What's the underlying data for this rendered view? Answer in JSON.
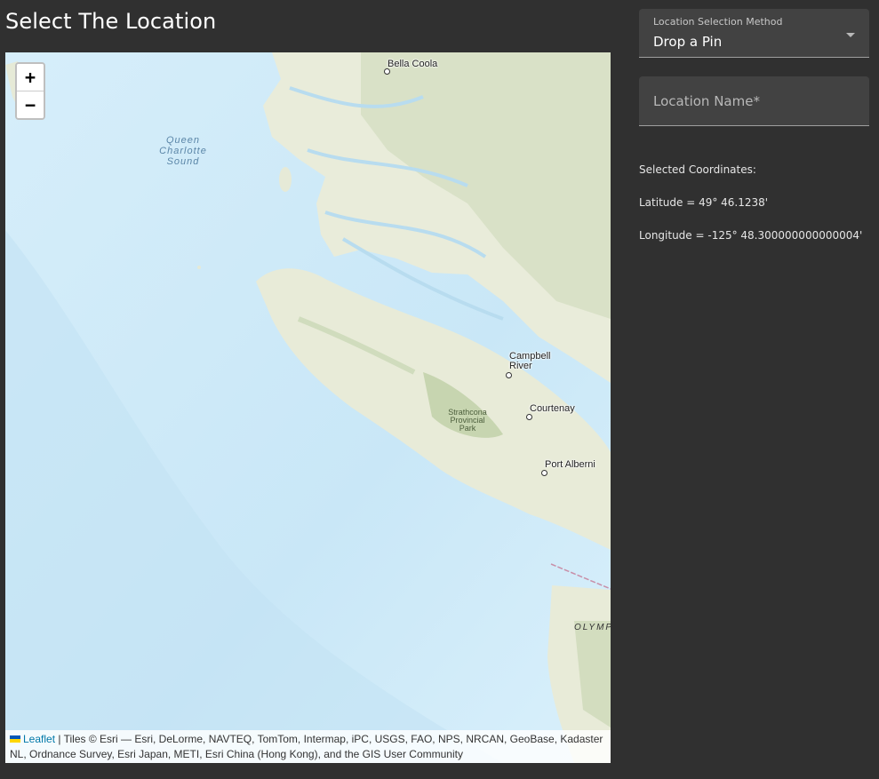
{
  "page": {
    "title": "Select The Location"
  },
  "map": {
    "zoom_in_label": "+",
    "zoom_out_label": "−",
    "labels": {
      "bella_coola": "Bella Coola",
      "queen_charlotte_sound": [
        "Queen",
        "Charlotte",
        "Sound"
      ],
      "campbell_river": [
        "Campbell",
        "River"
      ],
      "courtenay": "Courtenay",
      "strathcona": [
        "Strathcona",
        "Provincial",
        "Park"
      ],
      "port_alberni": "Port Alberni",
      "olympic": "OLYMP"
    },
    "attribution": {
      "leaflet_link": "Leaflet",
      "text": " | Tiles © Esri — Esri, DeLorme, NAVTEQ, TomTom, Intermap, iPC, USGS, FAO, NPS, NRCAN, GeoBase, Kadaster NL, Ordnance Survey, Esri Japan, METI, Esri China (Hong Kong), and the GIS User Community"
    },
    "colors": {
      "water": "#d4ecf8",
      "deep_water": "#c4e3f5",
      "land": "#e8ebd9",
      "forest": "#cfdcbc",
      "relief": "#b9c6a4"
    }
  },
  "form": {
    "method": {
      "label": "Location Selection Method",
      "value": "Drop a Pin"
    },
    "location_name": {
      "placeholder": "Location Name*",
      "value": ""
    }
  },
  "coordinates": {
    "heading": "Selected Coordinates:",
    "latitude": "Latitude = 49° 46.1238'",
    "longitude": "Longitude = -125° 48.300000000000004'"
  }
}
